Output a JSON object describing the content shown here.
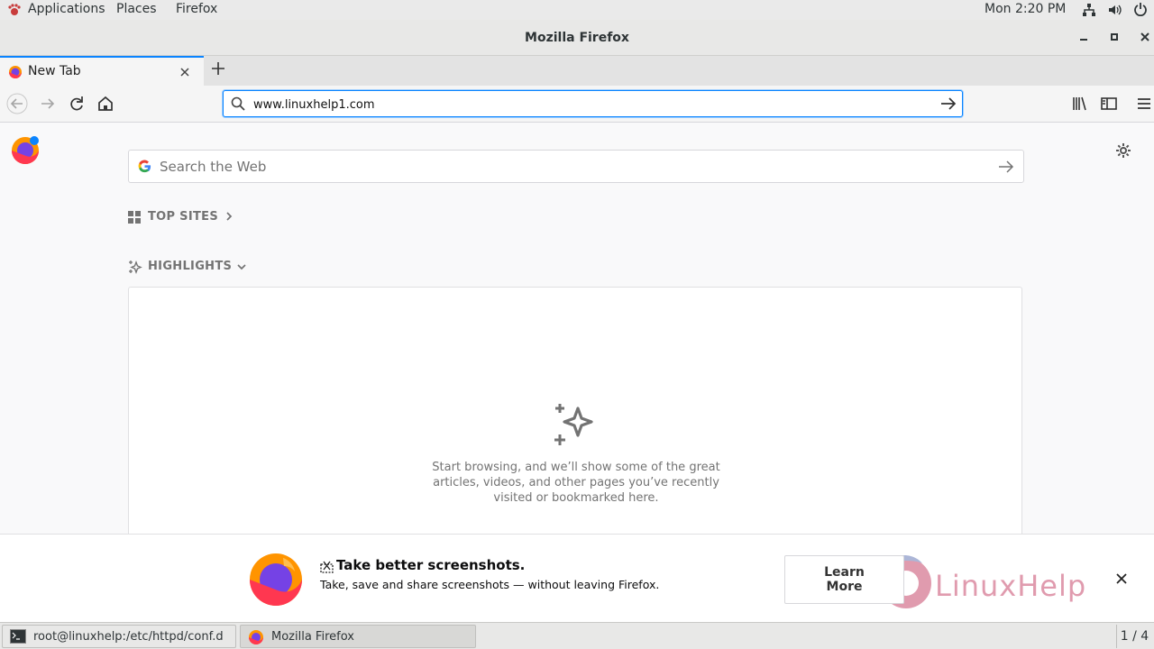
{
  "topbar": {
    "applications": "Applications",
    "places": "Places",
    "app_menu": "Firefox",
    "clock": "Mon  2:20 PM"
  },
  "window": {
    "title": "Mozilla Firefox"
  },
  "tabs": [
    {
      "label": "New Tab",
      "active": true
    }
  ],
  "urlbar": {
    "value": "www.linuxhelp1.com"
  },
  "newtab_page": {
    "search_placeholder": "Search the Web",
    "top_sites_label": "TOP SITES",
    "highlights_label": "HIGHLIGHTS",
    "empty_line1": "Start browsing, and we’ll show some of the great",
    "empty_line2": "articles, videos, and other pages you’ve recently",
    "empty_line3": "visited or bookmarked here."
  },
  "snippet": {
    "title": "Take better screenshots.",
    "text": "Take, save and share screenshots — without leaving Firefox.",
    "button_line1": "Learn",
    "button_line2": "More",
    "watermark": "LinuxHelp"
  },
  "taskbar": {
    "items": [
      {
        "label": "root@linuxhelp:/etc/httpd/conf.d"
      },
      {
        "label": "Mozilla Firefox"
      }
    ],
    "workspace": "1 / 4"
  },
  "colors": {
    "accent": "#0a84ff",
    "topbar_bg": "#eaeaea",
    "content_bg": "#f9f9fa"
  }
}
